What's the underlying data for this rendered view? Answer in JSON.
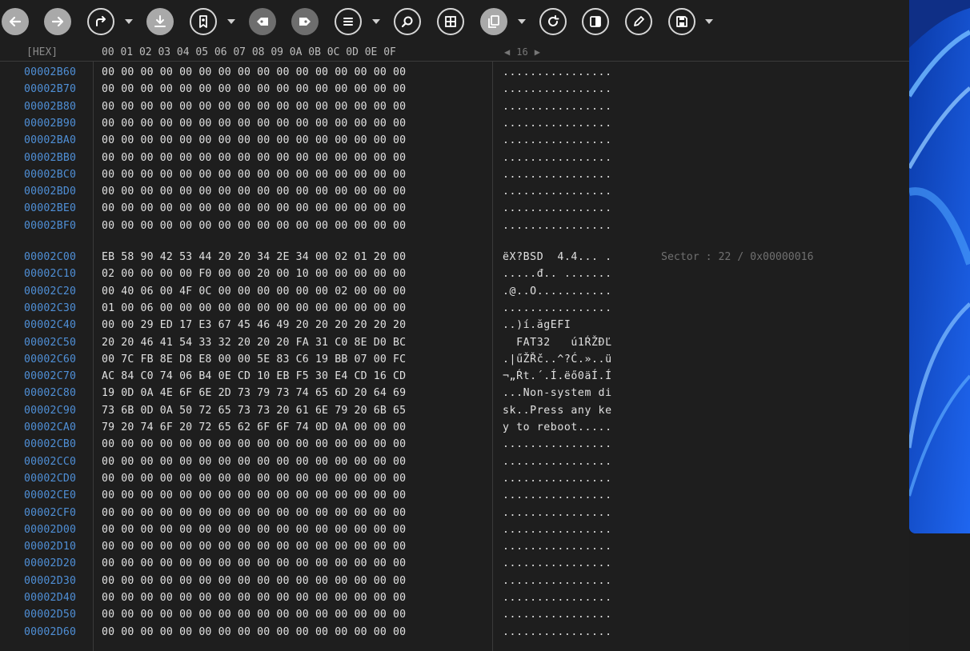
{
  "toolbar": {
    "buttons": [
      {
        "name": "back-button",
        "icon": "arrow-left-icon"
      },
      {
        "name": "forward-button",
        "icon": "arrow-right-icon"
      },
      {
        "name": "goto-button",
        "icon": "redo-arrow-icon"
      },
      {
        "name": "download-button",
        "icon": "download-icon"
      },
      {
        "name": "bookmark-button",
        "icon": "bookmark-icon"
      },
      {
        "name": "prev-bookmark-button",
        "icon": "tag-left-icon"
      },
      {
        "name": "next-bookmark-button",
        "icon": "tag-right-icon"
      },
      {
        "name": "list-button",
        "icon": "list-icon"
      },
      {
        "name": "search-button",
        "icon": "search-icon"
      },
      {
        "name": "grid-button",
        "icon": "grid-icon"
      },
      {
        "name": "copy-button",
        "icon": "copy-icon"
      },
      {
        "name": "refresh-button",
        "icon": "refresh-icon"
      },
      {
        "name": "panel-button",
        "icon": "panel-icon"
      },
      {
        "name": "edit-button",
        "icon": "pencil-icon"
      },
      {
        "name": "save-button",
        "icon": "save-icon"
      }
    ]
  },
  "header": {
    "hex_label": "[HEX]",
    "columns": "00 01 02 03 04 05 06 07 08 09 0A 0B 0C 0D 0E 0F",
    "nav_prev": "◀",
    "bytes_per_row": "16",
    "nav_next": "▶"
  },
  "rows": [
    {
      "addr": "00002B60",
      "hex": "00 00 00 00 00 00 00 00 00 00 00 00 00 00 00 00",
      "ascii": "................"
    },
    {
      "addr": "00002B70",
      "hex": "00 00 00 00 00 00 00 00 00 00 00 00 00 00 00 00",
      "ascii": "................"
    },
    {
      "addr": "00002B80",
      "hex": "00 00 00 00 00 00 00 00 00 00 00 00 00 00 00 00",
      "ascii": "................"
    },
    {
      "addr": "00002B90",
      "hex": "00 00 00 00 00 00 00 00 00 00 00 00 00 00 00 00",
      "ascii": "................"
    },
    {
      "addr": "00002BA0",
      "hex": "00 00 00 00 00 00 00 00 00 00 00 00 00 00 00 00",
      "ascii": "................"
    },
    {
      "addr": "00002BB0",
      "hex": "00 00 00 00 00 00 00 00 00 00 00 00 00 00 00 00",
      "ascii": "................"
    },
    {
      "addr": "00002BC0",
      "hex": "00 00 00 00 00 00 00 00 00 00 00 00 00 00 00 00",
      "ascii": "................"
    },
    {
      "addr": "00002BD0",
      "hex": "00 00 00 00 00 00 00 00 00 00 00 00 00 00 00 00",
      "ascii": "................"
    },
    {
      "addr": "00002BE0",
      "hex": "00 00 00 00 00 00 00 00 00 00 00 00 00 00 00 00",
      "ascii": "................"
    },
    {
      "addr": "00002BF0",
      "hex": "00 00 00 00 00 00 00 00 00 00 00 00 00 00 00 00",
      "ascii": "................"
    },
    {
      "addr": "00002C00",
      "hex": "EB 58 90 42 53 44 20 20 34 2E 34 00 02 01 20 00",
      "ascii": "ëX?BSD  4.4... .",
      "sector": "Sector : 22 / 0x00000016"
    },
    {
      "addr": "00002C10",
      "hex": "02 00 00 00 00 F0 00 00 20 00 10 00 00 00 00 00",
      "ascii": ".....đ.. ......."
    },
    {
      "addr": "00002C20",
      "hex": "00 40 06 00 4F 0C 00 00 00 00 00 00 02 00 00 00",
      "ascii": ".@..O..........."
    },
    {
      "addr": "00002C30",
      "hex": "01 00 06 00 00 00 00 00 00 00 00 00 00 00 00 00",
      "ascii": "................"
    },
    {
      "addr": "00002C40",
      "hex": "00 00 29 ED 17 E3 67 45 46 49 20 20 20 20 20 20",
      "ascii": "..)í.ăgEFI      "
    },
    {
      "addr": "00002C50",
      "hex": "20 20 46 41 54 33 32 20 20 20 FA 31 C0 8E D0 BC",
      "ascii": "  FAT32   ú1ŔŽĐĽ"
    },
    {
      "addr": "00002C60",
      "hex": "00 7C FB 8E D8 E8 00 00 5E 83 C6 19 BB 07 00 FC",
      "ascii": ".|űŽŘč..^?Ć.»..ü"
    },
    {
      "addr": "00002C70",
      "hex": "AC 84 C0 74 06 B4 0E CD 10 EB F5 30 E4 CD 16 CD",
      "ascii": "¬„Ŕt.´.Í.ëő0äÍ.Í"
    },
    {
      "addr": "00002C80",
      "hex": "19 0D 0A 4E 6F 6E 2D 73 79 73 74 65 6D 20 64 69",
      "ascii": "...Non-system di"
    },
    {
      "addr": "00002C90",
      "hex": "73 6B 0D 0A 50 72 65 73 73 20 61 6E 79 20 6B 65",
      "ascii": "sk..Press any ke"
    },
    {
      "addr": "00002CA0",
      "hex": "79 20 74 6F 20 72 65 62 6F 6F 74 0D 0A 00 00 00",
      "ascii": "y to reboot....."
    },
    {
      "addr": "00002CB0",
      "hex": "00 00 00 00 00 00 00 00 00 00 00 00 00 00 00 00",
      "ascii": "................"
    },
    {
      "addr": "00002CC0",
      "hex": "00 00 00 00 00 00 00 00 00 00 00 00 00 00 00 00",
      "ascii": "................"
    },
    {
      "addr": "00002CD0",
      "hex": "00 00 00 00 00 00 00 00 00 00 00 00 00 00 00 00",
      "ascii": "................"
    },
    {
      "addr": "00002CE0",
      "hex": "00 00 00 00 00 00 00 00 00 00 00 00 00 00 00 00",
      "ascii": "................"
    },
    {
      "addr": "00002CF0",
      "hex": "00 00 00 00 00 00 00 00 00 00 00 00 00 00 00 00",
      "ascii": "................"
    },
    {
      "addr": "00002D00",
      "hex": "00 00 00 00 00 00 00 00 00 00 00 00 00 00 00 00",
      "ascii": "................"
    },
    {
      "addr": "00002D10",
      "hex": "00 00 00 00 00 00 00 00 00 00 00 00 00 00 00 00",
      "ascii": "................"
    },
    {
      "addr": "00002D20",
      "hex": "00 00 00 00 00 00 00 00 00 00 00 00 00 00 00 00",
      "ascii": "................"
    },
    {
      "addr": "00002D30",
      "hex": "00 00 00 00 00 00 00 00 00 00 00 00 00 00 00 00",
      "ascii": "................"
    },
    {
      "addr": "00002D40",
      "hex": "00 00 00 00 00 00 00 00 00 00 00 00 00 00 00 00",
      "ascii": "................"
    },
    {
      "addr": "00002D50",
      "hex": "00 00 00 00 00 00 00 00 00 00 00 00 00 00 00 00",
      "ascii": "................"
    },
    {
      "addr": "00002D60",
      "hex": "00 00 00 00 00 00 00 00 00 00 00 00 00 00 00 00",
      "ascii": "................"
    }
  ],
  "colors": {
    "address": "#4f8fd6",
    "background": "#1e1e1e",
    "wallpaper": "#1548c8"
  }
}
